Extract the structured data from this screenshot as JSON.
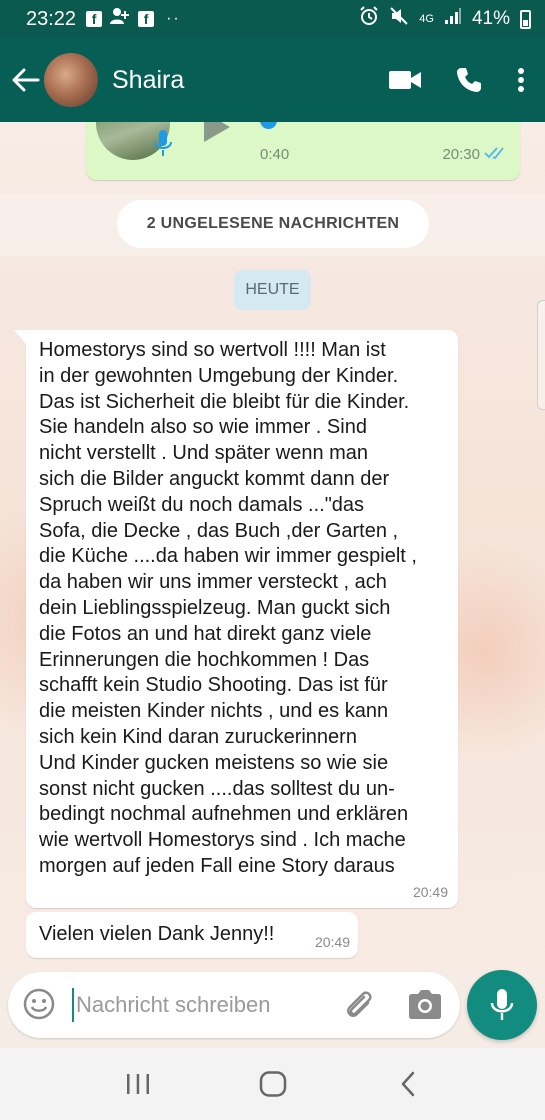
{
  "status_bar": {
    "time": "23:22",
    "battery": "41%",
    "network": "4G",
    "left_icons": [
      "facebook-icon",
      "add-person-icon",
      "facebook-icon"
    ],
    "right_icons": [
      "alarm-icon",
      "mute-icon",
      "signal-icon",
      "battery-icon"
    ]
  },
  "header": {
    "contact_name": "Shaira",
    "background": "#075e54",
    "icons": [
      "back-arrow-icon",
      "video-call-icon",
      "phone-icon",
      "more-vert-icon"
    ]
  },
  "voice_message": {
    "duration": "0:40",
    "time": "20:30",
    "read_color": "#4fb6ec"
  },
  "unread_banner": "2 UNGELESENE NACHRICHTEN",
  "date_label": "HEUTE",
  "messages": [
    {
      "text": "Homestorys sind so wertvoll !!!! Man ist\nin der gewohnten Umgebung der Kinder.\nDas ist Sicherheit die bleibt für die Kinder.\nSie handeln also so wie immer . Sind\nnicht verstellt . Und später wenn man\nsich die Bilder anguckt kommt dann der\nSpruch  weißt du noch damals ...\"das\nSofa, die Decke , das Buch ,der Garten ,\ndie Küche ....da haben wir immer gespielt ,\nda haben wir uns immer versteckt , ach\ndein Lieblingsspielzeug. Man guckt sich\ndie Fotos an und hat direkt ganz viele\nErinnerungen die hochkommen ! Das\nschafft kein Studio Shooting. Das ist für\ndie meisten Kinder nichts , und es kann\nsich kein Kind daran zuruckerinnern\n Und Kinder gucken meistens so wie sie\nsonst nicht gucken ....das solltest du un-\nbedingt nochmal aufnehmen und erklären\nwie wertvoll Homestorys sind . Ich mache\nmorgen auf jeden Fall eine Story daraus",
      "time": "20:49"
    },
    {
      "text": "Vielen vielen Dank Jenny!!",
      "time": "20:49"
    }
  ],
  "composer": {
    "placeholder": "Nachricht schreiben",
    "value": "",
    "accent": "#128c7e",
    "icons": [
      "emoji-icon",
      "paperclip-icon",
      "camera-icon",
      "mic-icon"
    ]
  },
  "nav_bar": {
    "icons": [
      "recents-icon",
      "home-icon",
      "back-icon"
    ]
  }
}
